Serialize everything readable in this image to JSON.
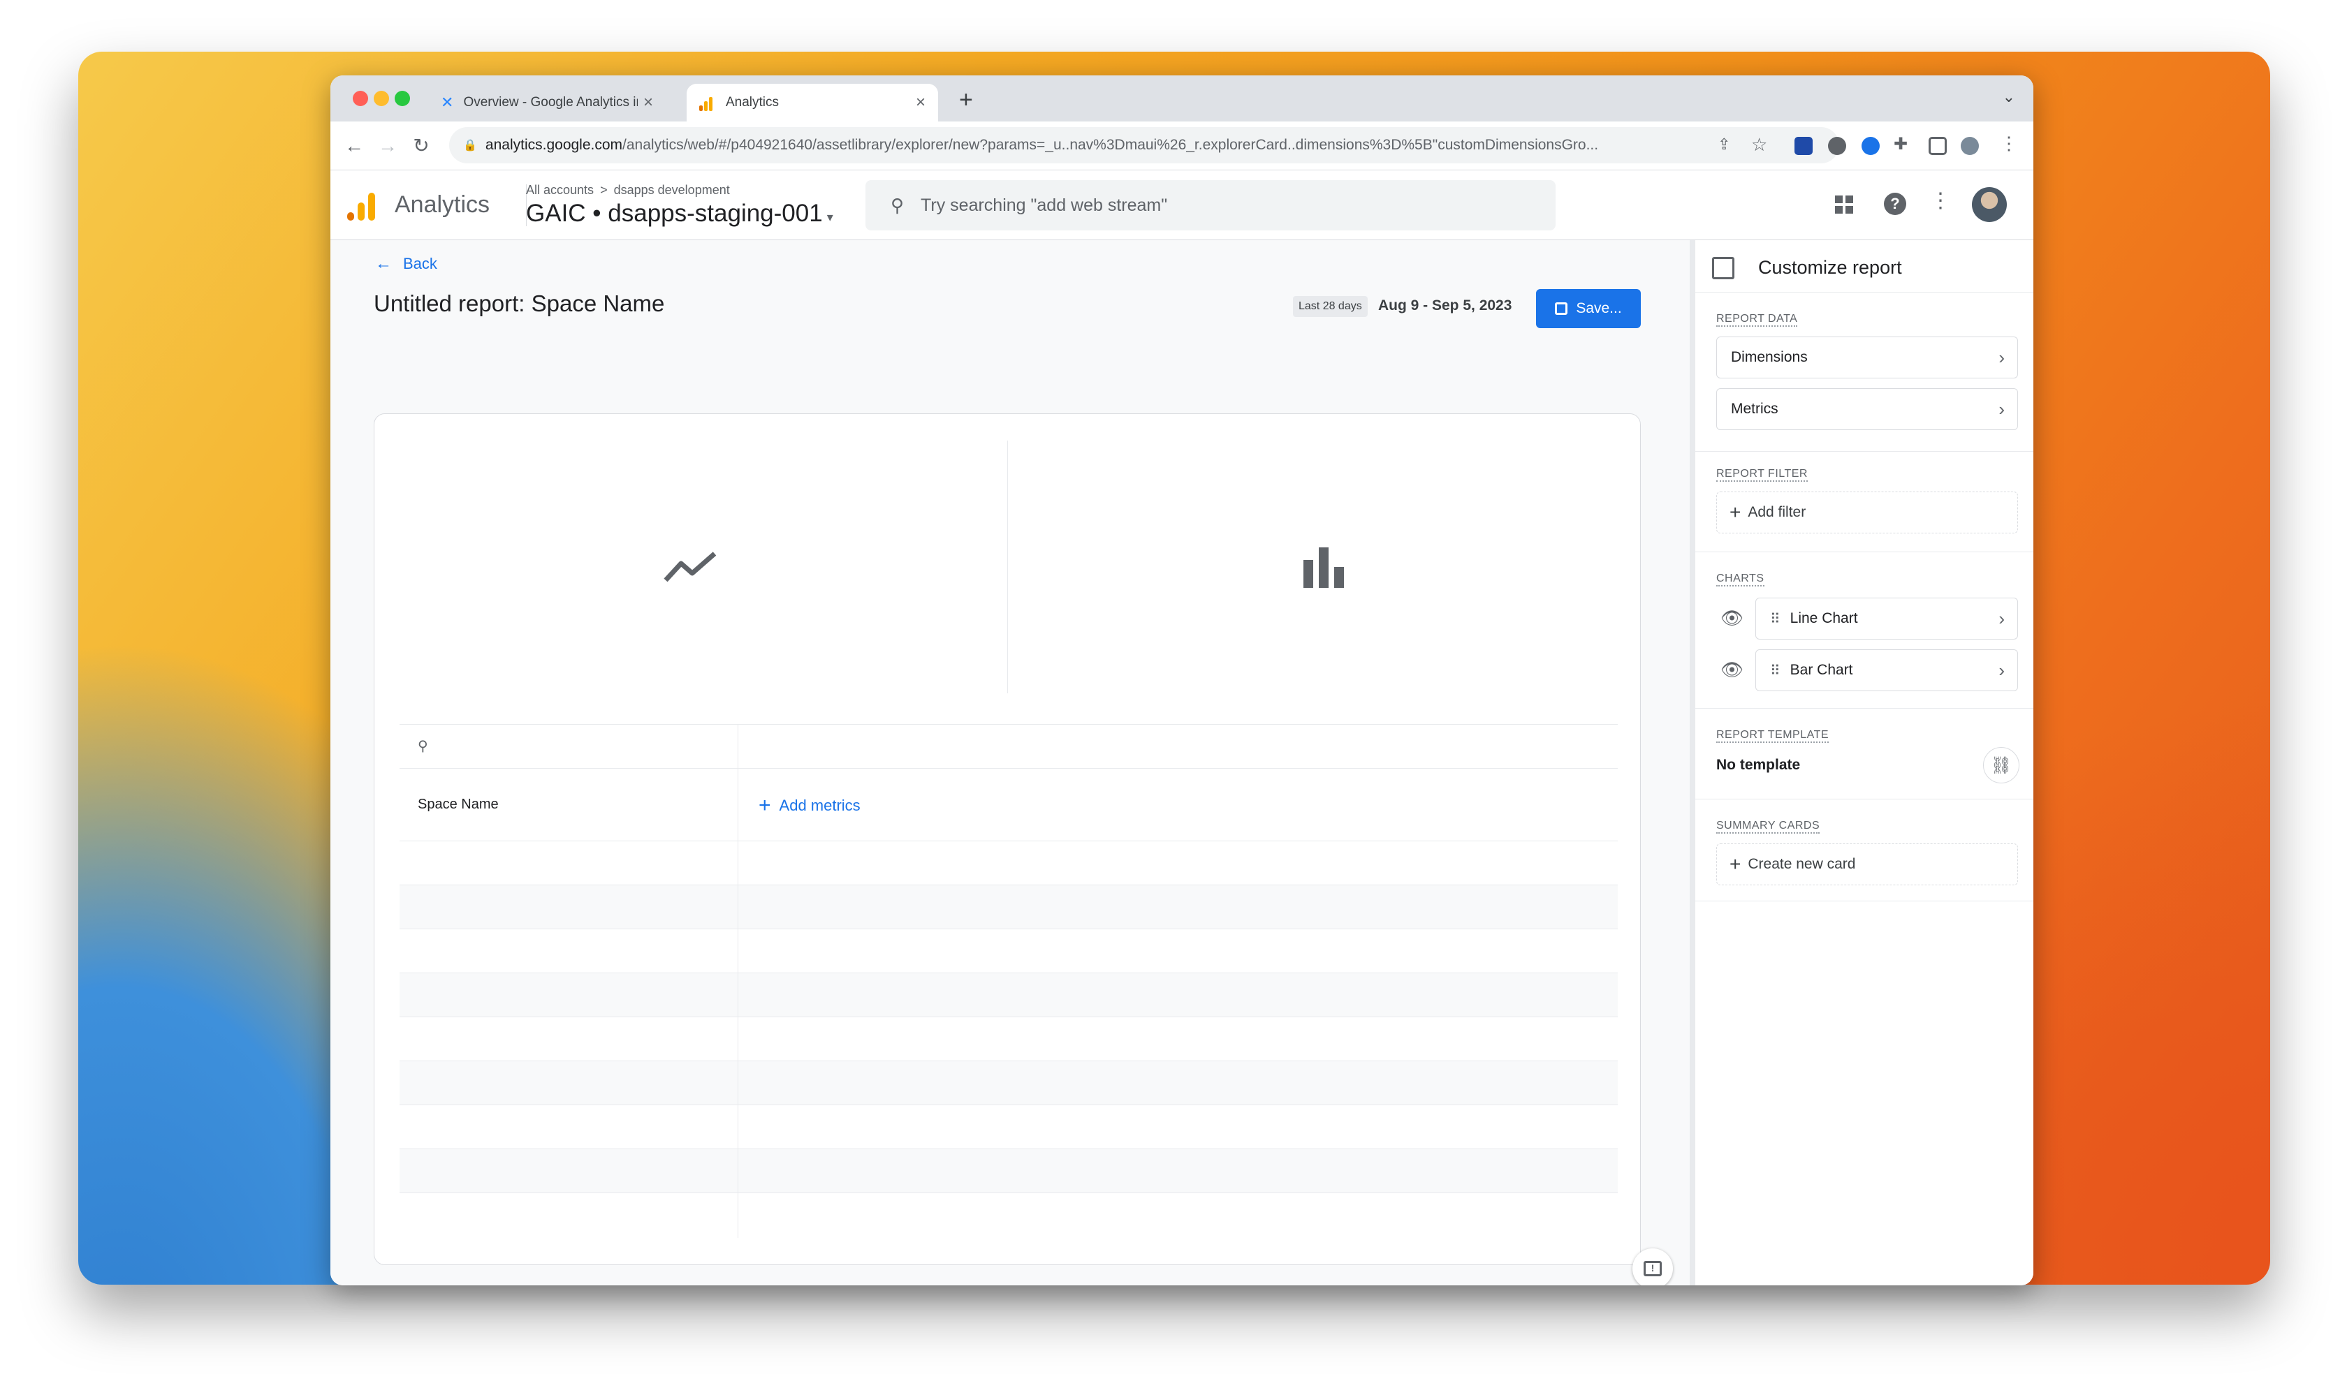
{
  "browser": {
    "tabs": [
      {
        "label": "Overview - Google Analytics in"
      },
      {
        "label": "Analytics"
      }
    ],
    "url_host": "analytics.google.com",
    "url_path": "/analytics/web/#/p404921640/assetlibrary/explorer/new?params=_u..nav%3Dmaui%26_r.explorerCard..dimensions%3D%5B\"customDimensionsGro...",
    "new_tab_label": "+"
  },
  "appbar": {
    "product": "Analytics",
    "breadcrumb_all": "All accounts",
    "breadcrumb_sep": ">",
    "breadcrumb_account": "dsapps development",
    "property": "GAIC • dsapps-staging-001",
    "search_placeholder": "Try searching \"add web stream\""
  },
  "report": {
    "back_label": "Back",
    "title": "Untitled report: Space Name",
    "date_chip": "Last 28 days",
    "date_range": "Aug 9 - Sep 5, 2023",
    "save_label": "Save...",
    "col_dimension": "Space Name",
    "add_metrics": "Add metrics"
  },
  "sidebar": {
    "title": "Customize report",
    "report_data_h": "REPORT DATA",
    "dimensions": "Dimensions",
    "metrics": "Metrics",
    "report_filter_h": "REPORT FILTER",
    "add_filter": "Add filter",
    "charts_h": "CHARTS",
    "line_chart": "Line Chart",
    "bar_chart": "Bar Chart",
    "template_h": "REPORT TEMPLATE",
    "template_value": "No template",
    "summary_h": "SUMMARY CARDS",
    "create_card": "Create new card"
  },
  "colors": {
    "accent": "#1a73e8",
    "analytics_orange": "#f9ab00",
    "analytics_dark": "#e37400"
  }
}
